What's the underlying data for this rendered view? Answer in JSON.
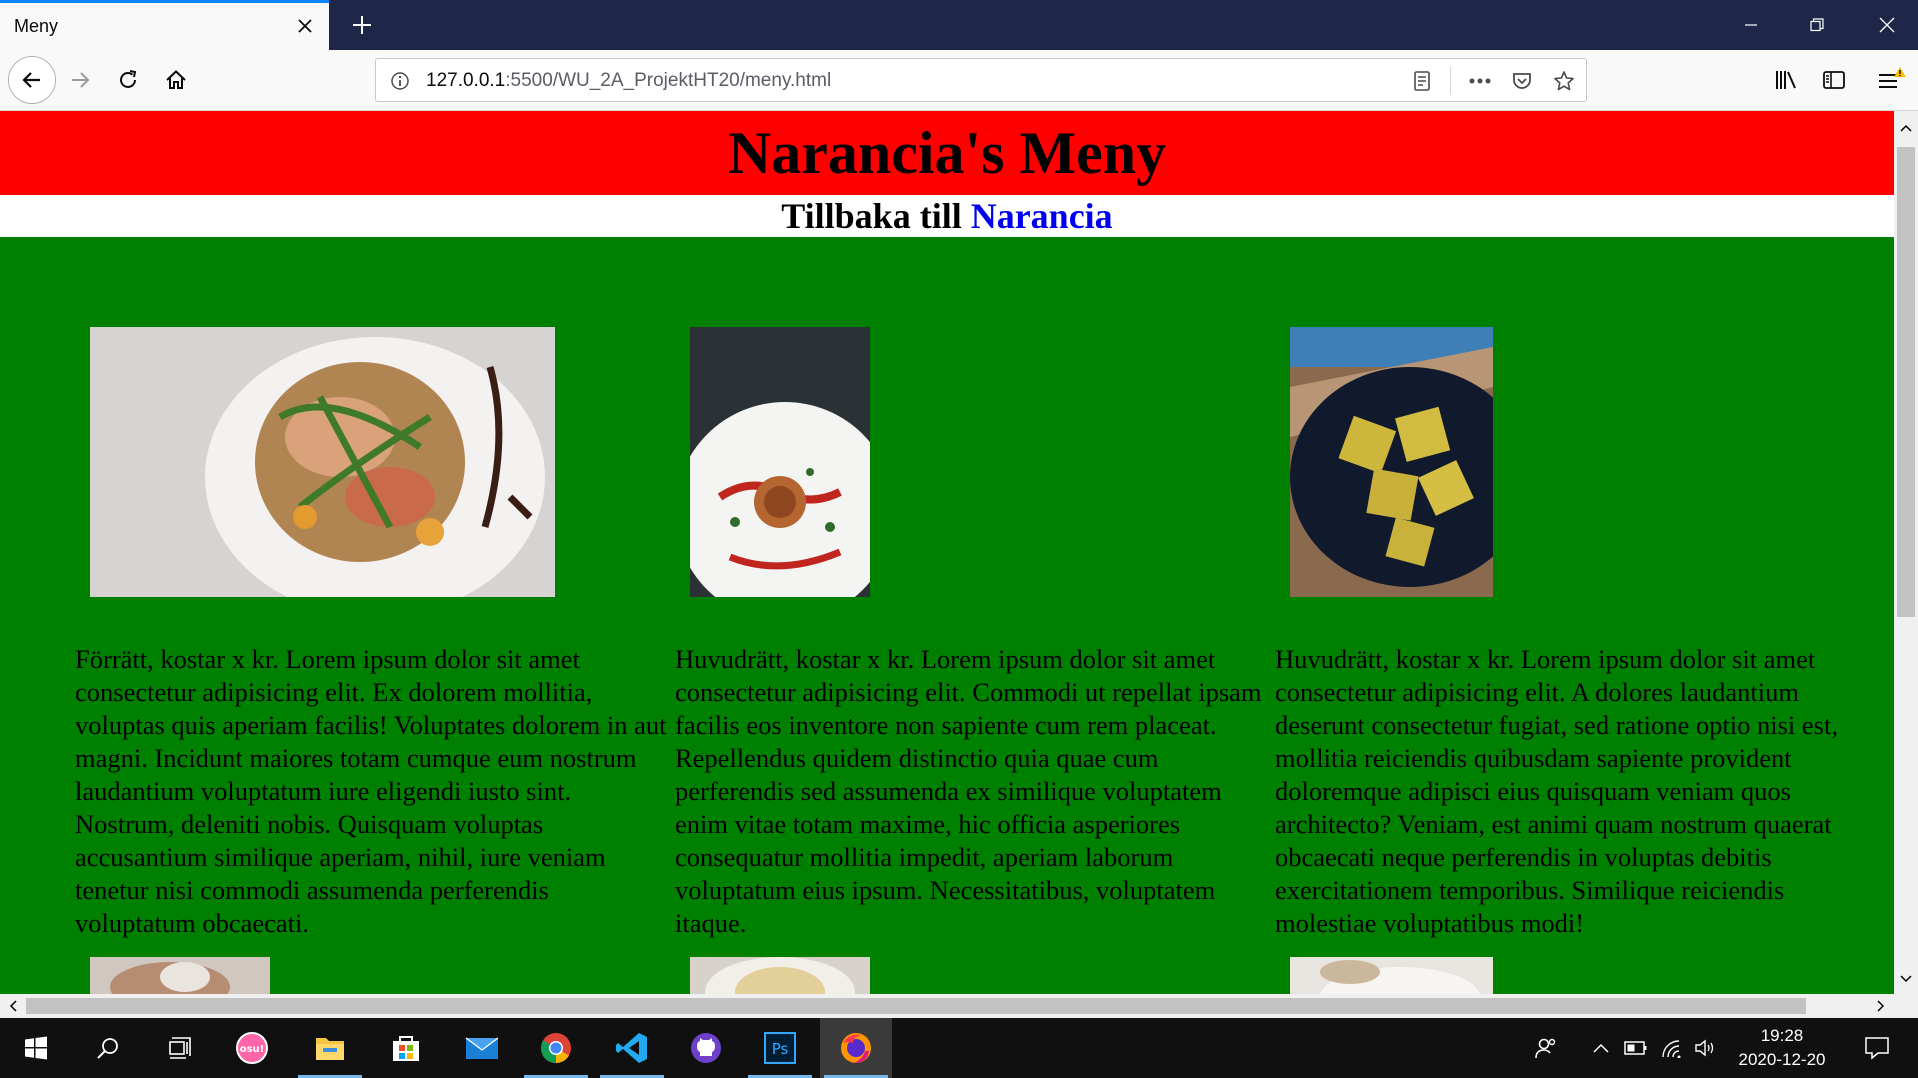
{
  "browser": {
    "tab_title": "Meny",
    "url_host": "127.0.0.1",
    "url_rest": ":5500/WU_2A_ProjektHT20/meny.html",
    "accent_color": "#0a84ff"
  },
  "page": {
    "title": "Narancia's Meny",
    "back_prefix": "Tillbaka till",
    "back_link": "Narancia",
    "header_color": "#ff0000",
    "background_color": "#008000",
    "dishes": [
      {
        "image": "salad-plate-photo",
        "text": "Förrätt, kostar x kr. Lorem ipsum dolor sit amet consectetur adipisicing elit. Ex dolorem mollitia, voluptas quis aperiam facilis! Voluptates dolorem in aut magni. Incidunt maiores totam cumque eum nostrum laudantium voluptatum iure eligendi iusto sint. Nostrum, deleniti nobis. Quisquam voluptas accusantium similique aperiam, nihil, iure veniam tenetur nisi commodi assumenda perferendis voluptatum obcaecati."
      },
      {
        "image": "spaghetti-plate-photo",
        "text": "Huvudrätt, kostar x kr. Lorem ipsum dolor sit amet consectetur adipisicing elit. Commodi ut repellat ipsam facilis eos inventore non sapiente cum rem placeat. Repellendus quidem distinctio quia quae cum perferendis sed assumenda ex similique voluptatem enim vitae totam maxime, hic officia asperiores consequatur mollitia impedit, aperiam laborum voluptatum eius ipsum. Necessitatibus, voluptatem itaque."
      },
      {
        "image": "ravioli-plate-photo",
        "text": "Huvudrätt, kostar x kr. Lorem ipsum dolor sit amet consectetur adipisicing elit. A dolores laudantium deserunt consectetur fugiat, sed ratione optio nisi est, mollitia reiciendis quibusdam sapiente provident doloremque adipisci eius quisquam veniam quos architecto? Veniam, est animi quam nostrum quaerat obcaecati neque perferendis in voluptas debitis exercitationem temporibus. Similique reiciendis molestiae voluptatibus modi!"
      }
    ]
  },
  "taskbar": {
    "apps": [
      "windows-start",
      "search",
      "task-view",
      "osu",
      "file-explorer",
      "microsoft-store",
      "mail",
      "chrome",
      "vscode",
      "github-desktop",
      "photoshop",
      "firefox"
    ],
    "osu_label": "osu!",
    "ps_label": "Ps",
    "time": "19:28",
    "date": "2020-12-20"
  }
}
